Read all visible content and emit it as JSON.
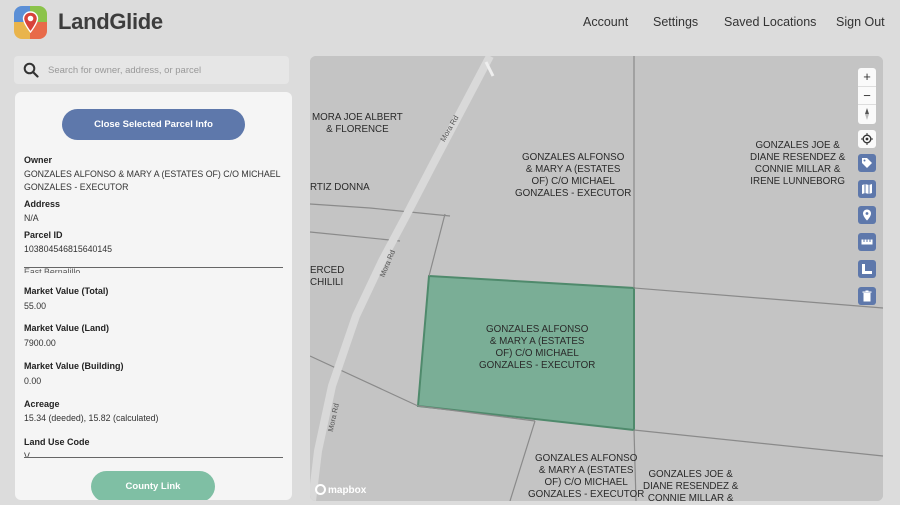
{
  "app": {
    "name": "LandGlide"
  },
  "nav": {
    "account": "Account",
    "settings": "Settings",
    "saved_locations": "Saved Locations",
    "sign_out": "Sign Out"
  },
  "search": {
    "placeholder": "Search for owner, address, or parcel",
    "value": ""
  },
  "panel": {
    "close_button": "Close Selected Parcel Info",
    "owner_label": "Owner",
    "owner_value": "GONZALES ALFONSO & MARY A (ESTATES OF) C/O MICHAEL GONZALES - EXECUTOR",
    "address_label": "Address",
    "address_value": "N/A",
    "parcel_label": "Parcel ID",
    "parcel_value": "103804546815640145",
    "clipped_row": "East Bernalillo",
    "market_total_label": "Market Value (Total)",
    "market_total_value": "55.00",
    "market_land_label": "Market Value (Land)",
    "market_land_value": "7900.00",
    "market_building_label": "Market Value (Building)",
    "market_building_value": "0.00",
    "acreage_label": "Acreage",
    "acreage_value": "15.34 (deeded), 15.82 (calculated)",
    "land_use_label": "Land Use Code",
    "land_use_value": "V",
    "county_button": "County Link"
  },
  "map": {
    "labels": {
      "mora_albert": "MORA JOE ALBERT\n& FLORENCE",
      "gonzales_top": "GONZALES ALFONSO\n& MARY A (ESTATES\nOF) C/O MICHAEL\nGONZALES - EXECUTOR",
      "gonzales_joe_top": "GONZALES JOE &\nDIANE RESENDEZ &\nCONNIE MILLAR &\nIRENE LUNNEBORG",
      "ortiz": "RTIZ DONNA",
      "merced": "ERCED\nCHILILI",
      "gonzales_selected": "GONZALES ALFONSO\n& MARY A (ESTATES\nOF) C/O MICHAEL\nGONZALES - EXECUTOR",
      "gonzales_bottom": "GONZALES ALFONSO\n& MARY A (ESTATES\nOF) C/O MICHAEL\nGONZALES - EXECUTOR",
      "gonzales_joe_bottom": "GONZALES JOE &\nDIANE RESENDEZ &\nCONNIE MILLAR &"
    },
    "road_label": "Mora Rd",
    "attribution": "mapbox",
    "zoom_in": "+",
    "zoom_out": "−"
  },
  "colors": {
    "primary_button": "#5e78ab",
    "county_button": "#7fbfa4",
    "selected_parcel": "#7aae96",
    "map_background": "#c4c4c4"
  }
}
